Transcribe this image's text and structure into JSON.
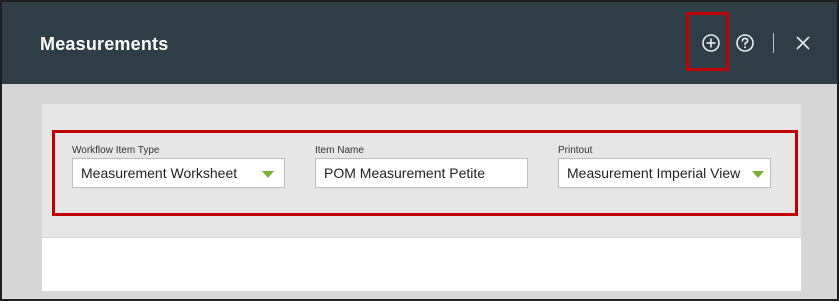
{
  "dialog": {
    "title": "Measurements"
  },
  "header_actions": {
    "add_icon": "plus-circle",
    "help_icon": "question-circle",
    "close_icon": "x"
  },
  "fields": {
    "workflow_item_type": {
      "label": "Workflow Item Type",
      "value": "Measurement Worksheet"
    },
    "item_name": {
      "label": "Item Name",
      "value": "POM Measurement Petite"
    },
    "printout": {
      "label": "Printout",
      "value": "Measurement Imperial View"
    }
  },
  "colors": {
    "header_bg": "#2e3d46",
    "highlight_border": "#c00000",
    "caret": "#7cae34"
  }
}
